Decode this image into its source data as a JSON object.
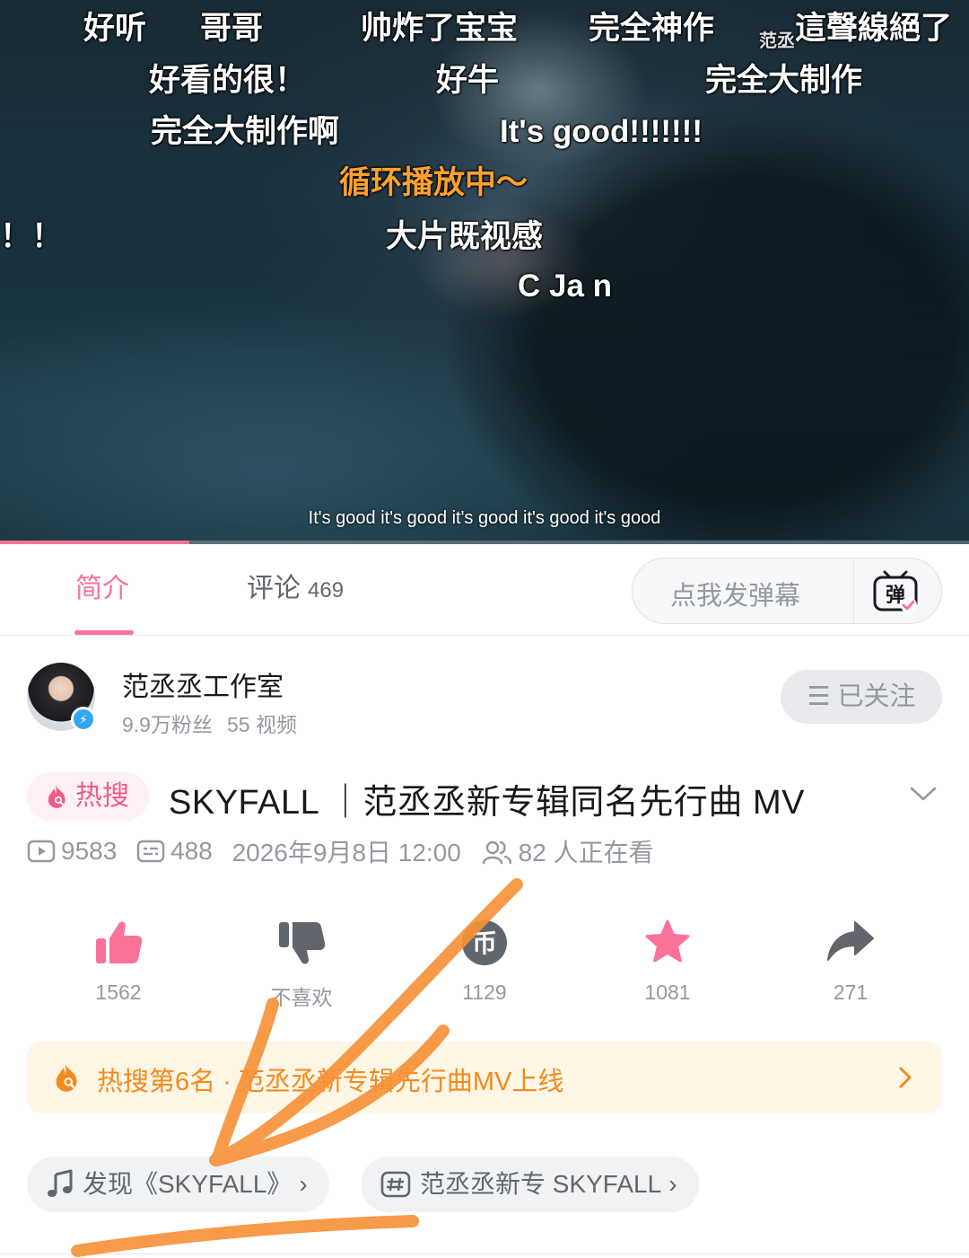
{
  "video": {
    "danmaku": [
      {
        "text": "好听",
        "color": "white"
      },
      {
        "text": "哥哥",
        "color": "white"
      },
      {
        "text": "帅炸了宝宝",
        "color": "white"
      },
      {
        "text": "完全神作",
        "color": "white"
      },
      {
        "text": "這聲線絕了",
        "color": "white"
      },
      {
        "text": "范丞",
        "color": "white"
      },
      {
        "text": "好看的很！",
        "color": "white"
      },
      {
        "text": "好牛",
        "color": "white"
      },
      {
        "text": "完全大制作",
        "color": "white"
      },
      {
        "text": "完全大制作啊",
        "color": "white"
      },
      {
        "text": "It's good!!!!!!!",
        "color": "white"
      },
      {
        "text": "循环播放中～",
        "color": "orange"
      },
      {
        "text": "！！",
        "color": "white"
      },
      {
        "text": "大片既视感",
        "color": "white"
      },
      {
        "text": "C Ja  n",
        "color": "white"
      }
    ],
    "subtitle": "It's good it's good it's good it's good it's good",
    "progress_fraction": 0.195
  },
  "tabs": {
    "intro": "简介",
    "comments": "评论",
    "comments_count": "469",
    "danmaku_placeholder": "点我发弹幕",
    "danmaku_toggle_glyph": "弹"
  },
  "uploader": {
    "name": "范丞丞工作室",
    "fans": "9.9万粉丝",
    "videos": "55 视频",
    "follow_glyph": "☰",
    "follow_label": "已关注"
  },
  "title": {
    "hot_tag": "热搜",
    "text": "SKYFALL ｜范丞丞新专辑同名先行曲 MV"
  },
  "meta": {
    "plays": "9583",
    "danmaku": "488",
    "date": "2026年9月8日 12:00",
    "watching": "82 人正在看"
  },
  "actions": {
    "like": "1562",
    "dislike": "不喜欢",
    "coin": "1129",
    "coin_glyph": "币",
    "favorite": "1081",
    "share": "271"
  },
  "hot_banner": {
    "text": "热搜第6名 · 范丞丞新专辑先行曲MV上线"
  },
  "chips": {
    "music": "发现《SKYFALL》",
    "topic": "范丞丞新专 SKYFALL",
    "chevron": "›"
  },
  "colors": {
    "accent": "#fb7299",
    "hot_orange": "#f38a1d",
    "annotation": "#f7923a"
  }
}
